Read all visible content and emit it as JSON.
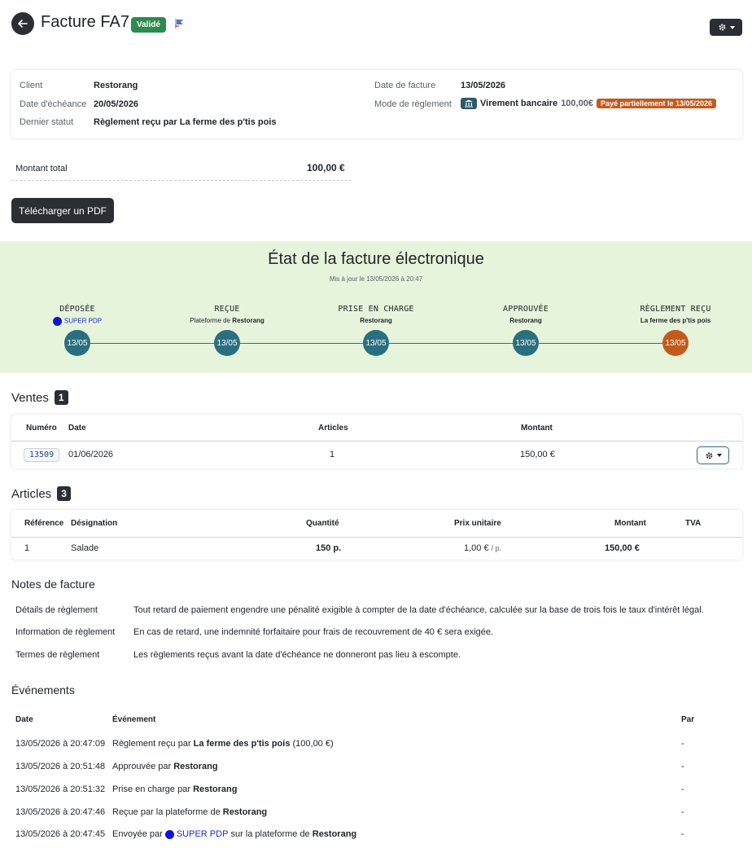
{
  "header": {
    "title": "Facture FA7",
    "status_badge": "Validé"
  },
  "info": {
    "client_label": "Client",
    "client_value": "Restorang",
    "due_label": "Date d'échéance",
    "due_value": "20/05/2026",
    "last_status_label": "Dernier statut",
    "last_status_value": "Règlement reçu par La ferme des p'tis pois",
    "invoice_date_label": "Date de facture",
    "invoice_date_value": "13/05/2026",
    "payment_mode_label": "Mode de règlement",
    "payment_mode_value": "Virement bancaire",
    "payment_amount": "100,00€",
    "payment_badge": "Payé partiellement le 13/05/2026"
  },
  "total": {
    "label": "Montant total",
    "value": "100,00 €"
  },
  "actions": {
    "download_pdf": "Télécharger un PDF"
  },
  "einvoice": {
    "title": "État de la facture électronique",
    "updated": "Mis à jour le 13/05/2026 à 20:47",
    "steps": [
      {
        "title": "DÉPOSÉE",
        "sub_prefix": "",
        "sub_bold": "",
        "sub_link": "SUPER PDP",
        "date": "13/05",
        "color": "#2a6f80"
      },
      {
        "title": "REÇUE",
        "sub_prefix": "Plateforme de ",
        "sub_bold": "Restorang",
        "sub_link": "",
        "date": "13/05",
        "color": "#2a6f80"
      },
      {
        "title": "PRISE EN CHARGE",
        "sub_prefix": "",
        "sub_bold": "Restorang",
        "sub_link": "",
        "date": "13/05",
        "color": "#2a6f80"
      },
      {
        "title": "APPROUVÉE",
        "sub_prefix": "",
        "sub_bold": "Restorang",
        "sub_link": "",
        "date": "13/05",
        "color": "#2a6f80"
      },
      {
        "title": "RÈGLEMENT REÇU",
        "sub_prefix": "",
        "sub_bold": "La ferme des p'tis pois",
        "sub_link": "",
        "date": "13/05",
        "color": "#c35a1c"
      }
    ]
  },
  "sales": {
    "heading": "Ventes",
    "count": "1",
    "columns": {
      "number": "Numéro",
      "date": "Date",
      "articles": "Articles",
      "amount": "Montant"
    },
    "rows": [
      {
        "number": "13509",
        "date": "01/06/2026",
        "articles": "1",
        "amount": "150,00 €"
      }
    ]
  },
  "articles": {
    "heading": "Articles",
    "count": "3",
    "columns": {
      "reference": "Référence",
      "designation": "Désignation",
      "quantity": "Quantité",
      "unit_price": "Prix unitaire",
      "amount": "Montant",
      "vat": "TVA"
    },
    "rows": [
      {
        "reference": "1",
        "designation": "Salade",
        "quantity": "150 p.",
        "unit_price": "1,00 €",
        "unit": "/ p.",
        "amount": "150,00 €",
        "vat": ""
      }
    ]
  },
  "notes": {
    "heading": "Notes de facture",
    "items": [
      {
        "label": "Détails de règlement",
        "text": "Tout retard de paiement engendre une pénalité exigible à compter de la date d'échéance, calculée sur la base de trois fois le taux d'intérêt légal."
      },
      {
        "label": "Information de règlement",
        "text": "En cas de retard, une indemnité forfaitaire pour frais de recouvrement de 40 € sera exigée."
      },
      {
        "label": "Termes de règlement",
        "text": "Les règlements reçus avant la date d'échéance ne donneront pas lieu à escompte."
      }
    ]
  },
  "events": {
    "heading": "Événements",
    "columns": {
      "date": "Date",
      "event": "Événement",
      "by": "Par"
    },
    "rows": [
      {
        "date": "13/05/2026 à 20:47:09",
        "pre": "Règlement reçu par ",
        "bold": "La ferme des p'tis pois",
        "post": " (100,00 €)",
        "link": "",
        "by": "-"
      },
      {
        "date": "13/05/2026 à 20:51:48",
        "pre": "Approuvée par ",
        "bold": "Restorang",
        "post": "",
        "link": "",
        "by": "-"
      },
      {
        "date": "13/05/2026 à 20:51:32",
        "pre": "Prise en charge par ",
        "bold": "Restorang",
        "post": "",
        "link": "",
        "by": "-"
      },
      {
        "date": "13/05/2026 à 20:47:46",
        "pre": "Reçue par la plateforme de ",
        "bold": "Restorang",
        "post": "",
        "link": "",
        "by": "-"
      },
      {
        "date": "13/05/2026 à 20:47:45",
        "pre": "Envoyée par ",
        "link": "SUPER PDP",
        "mid": " sur la plateforme de ",
        "bold": "Restorang",
        "post": "",
        "by": "-"
      }
    ]
  },
  "icons": {
    "back": "arrow-left-icon",
    "settings": "gear-icon",
    "bank": "bank-icon",
    "flag": "flag-icon"
  },
  "colors": {
    "dark": "#2b2e33",
    "valid": "#2d8a4e",
    "teal": "#2a6f80",
    "orange": "#c35a1c",
    "status_band": "#e6f4dc",
    "link_blue": "#1d2bd0"
  }
}
